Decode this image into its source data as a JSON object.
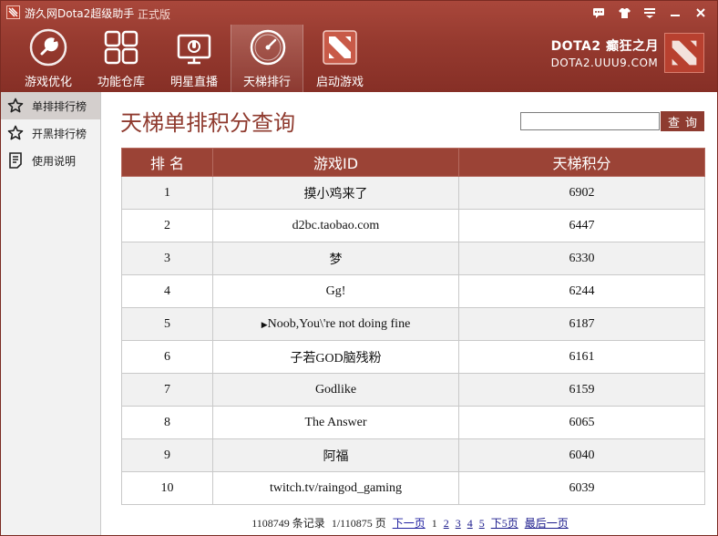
{
  "app": {
    "title": "游久网Dota2超级助手",
    "edition": "正式版"
  },
  "colors": {
    "brand_red": "#963a2f",
    "header_red": "#9b4336",
    "title_red": "#8f3a2e"
  },
  "window_controls": [
    "chat-icon",
    "shirt-icon",
    "menu-icon",
    "minimize-icon",
    "close-icon"
  ],
  "toolbar": {
    "items": [
      {
        "label": "游戏优化",
        "icon": "wrench-icon"
      },
      {
        "label": "功能仓库",
        "icon": "grid-icon"
      },
      {
        "label": "明星直播",
        "icon": "tv-icon"
      },
      {
        "label": "天梯排行",
        "icon": "gauge-icon",
        "active": true
      },
      {
        "label": "启动游戏",
        "icon": "dota-icon"
      }
    ]
  },
  "brand": {
    "line1": "DOTA2 癫狂之月",
    "line2": "DOTA2.UUU9.COM"
  },
  "sidebar": {
    "items": [
      {
        "label": "单排排行榜",
        "icon": "star-icon",
        "active": true
      },
      {
        "label": "开黑排行榜",
        "icon": "star-outline-icon"
      },
      {
        "label": "使用说明",
        "icon": "document-icon"
      }
    ]
  },
  "main": {
    "title": "天梯单排积分查询",
    "search": {
      "value": "",
      "placeholder": "",
      "button": "查询"
    },
    "table": {
      "headers": [
        "排 名",
        "游戏ID",
        "天梯积分"
      ],
      "rows": [
        {
          "rank": "1",
          "id": "摸小鸡来了",
          "score": "6902"
        },
        {
          "rank": "2",
          "id": "d2bc.taobao.com",
          "score": "6447"
        },
        {
          "rank": "3",
          "id": "梦",
          "score": "6330"
        },
        {
          "rank": "4",
          "id": "Gg!",
          "score": "6244"
        },
        {
          "rank": "5",
          "id": "Noob,You\\'re not doing fine",
          "score": "6187"
        },
        {
          "rank": "6",
          "id": "子若GOD脑残粉",
          "score": "6161"
        },
        {
          "rank": "7",
          "id": "Godlike",
          "score": "6159"
        },
        {
          "rank": "8",
          "id": "The Answer",
          "score": "6065"
        },
        {
          "rank": "9",
          "id": "阿福",
          "score": "6040"
        },
        {
          "rank": "10",
          "id": "twitch.tv/raingod_gaming",
          "score": "6039"
        }
      ]
    },
    "pager": {
      "records": "1108749 条记录",
      "page_info": "1/110875 页",
      "next": "下一页",
      "current": "1",
      "pages": [
        "2",
        "3",
        "4",
        "5"
      ],
      "next5": "下5页",
      "last": "最后一页"
    }
  }
}
